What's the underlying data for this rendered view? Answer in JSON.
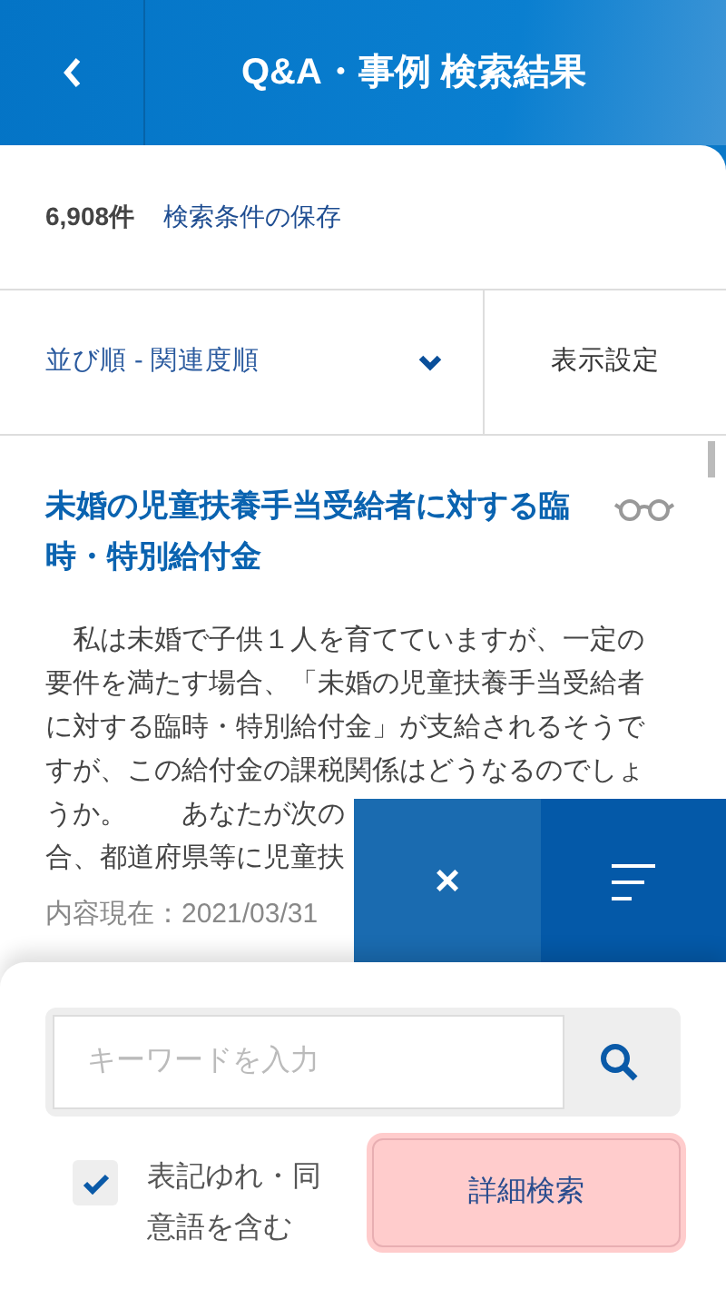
{
  "header": {
    "title": "Q&A・事例 検索結果"
  },
  "summary": {
    "count": "6,908件",
    "save_link": "検索条件の保存"
  },
  "sort": {
    "label": "並び順 - 関連度順",
    "display_settings": "表示設定"
  },
  "result": {
    "title": "未婚の児童扶養手当受給者に対する臨時・特別給付金",
    "snippet_lines": [
      "　私は未婚で子供１人を育てていますが、一定の",
      "要件を満たす場合、「未婚の児童扶養手当受給者",
      "に対する臨時・特別給付金」が支給されるそうで",
      "すが、この給付金の課税関係はどうなるのでしょ",
      "うか。　　あなたが次の",
      "合、都道府県等に児童扶"
    ],
    "date": "内容現在：2021/03/31"
  },
  "floating": {
    "close": "×"
  },
  "search": {
    "placeholder": "キーワードを入力",
    "include_variants": {
      "label": "表記ゆれ・同意語を含む",
      "checked": true
    },
    "advanced_button": "詳細検索"
  }
}
